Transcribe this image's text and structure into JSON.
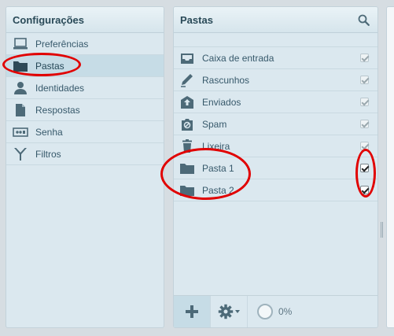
{
  "settings": {
    "title": "Configurações",
    "items": [
      {
        "label": "Preferências",
        "icon": "laptop-icon"
      },
      {
        "label": "Pastas",
        "icon": "folder-icon"
      },
      {
        "label": "Identidades",
        "icon": "person-icon"
      },
      {
        "label": "Respostas",
        "icon": "document-icon"
      },
      {
        "label": "Senha",
        "icon": "password-icon"
      },
      {
        "label": "Filtros",
        "icon": "filter-icon"
      }
    ],
    "selected": "Pastas"
  },
  "folders": {
    "title": "Pastas",
    "items": [
      {
        "name": "Caixa de entrada",
        "icon": "inbox-icon",
        "subscribed": true
      },
      {
        "name": "Rascunhos",
        "icon": "pencil-icon",
        "subscribed": true
      },
      {
        "name": "Enviados",
        "icon": "sent-icon",
        "subscribed": true
      },
      {
        "name": "Spam",
        "icon": "spam-icon",
        "subscribed": true
      },
      {
        "name": "Lixeira",
        "icon": "trash-icon",
        "subscribed": true
      },
      {
        "name": "Pasta 1",
        "icon": "folder-icon",
        "subscribed": true
      },
      {
        "name": "Pasta 2",
        "icon": "folder-icon",
        "subscribed": true
      }
    ],
    "quota": "0%"
  },
  "colors": {
    "accent": "#37596b",
    "annotation": "#e10000"
  }
}
